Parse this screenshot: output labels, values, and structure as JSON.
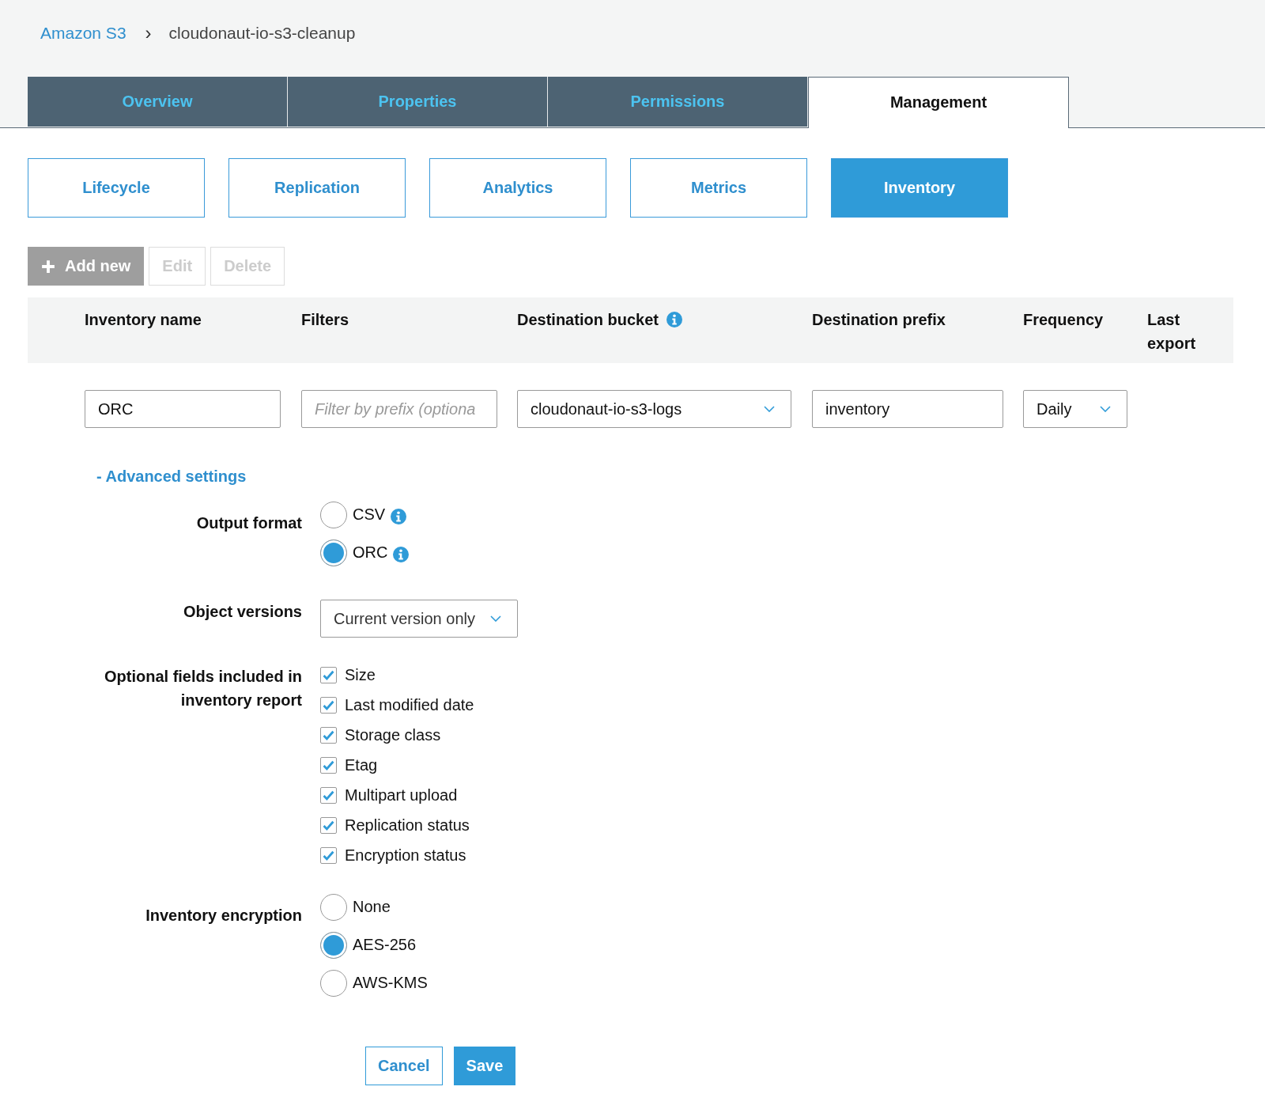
{
  "breadcrumb": {
    "root": "Amazon S3",
    "separator": "›",
    "current": "cloudonaut-io-s3-cleanup"
  },
  "tabs": [
    {
      "label": "Overview",
      "selected": false
    },
    {
      "label": "Properties",
      "selected": false
    },
    {
      "label": "Permissions",
      "selected": false
    },
    {
      "label": "Management",
      "selected": true
    }
  ],
  "subtabs": [
    {
      "label": "Lifecycle",
      "selected": false
    },
    {
      "label": "Replication",
      "selected": false
    },
    {
      "label": "Analytics",
      "selected": false
    },
    {
      "label": "Metrics",
      "selected": false
    },
    {
      "label": "Inventory",
      "selected": true
    }
  ],
  "toolbar": [
    {
      "label": "Add new",
      "kind": "add",
      "disabled": true
    },
    {
      "label": "Edit",
      "kind": "plain",
      "disabled": true
    },
    {
      "label": "Delete",
      "kind": "plain",
      "disabled": true
    }
  ],
  "table": {
    "columns": [
      {
        "label": "Inventory name"
      },
      {
        "label": "Filters"
      },
      {
        "label": "Destination bucket",
        "info": true
      },
      {
        "label": "Destination prefix"
      },
      {
        "label": "Frequency"
      },
      {
        "label": "Last export"
      }
    ],
    "row": {
      "name": {
        "value": "ORC"
      },
      "filter": {
        "placeholder": "Filter by prefix (optiona"
      },
      "bucket": {
        "value": "cloudonaut-io-s3-logs"
      },
      "prefix": {
        "value": "inventory"
      },
      "frequency": {
        "value": "Daily"
      }
    }
  },
  "advanced_toggle": "- Advanced settings",
  "output_format": {
    "label": "Output format",
    "options": [
      {
        "label": "CSV",
        "selected": false,
        "info": true
      },
      {
        "label": "ORC",
        "selected": true,
        "info": true
      }
    ]
  },
  "object_versions": {
    "label": "Object versions",
    "value": "Current version only"
  },
  "optional_fields": {
    "label": "Optional fields included in inventory report",
    "items": [
      {
        "label": "Size",
        "checked": true
      },
      {
        "label": "Last modified date",
        "checked": true
      },
      {
        "label": "Storage class",
        "checked": true
      },
      {
        "label": "Etag",
        "checked": true
      },
      {
        "label": "Multipart upload",
        "checked": true
      },
      {
        "label": "Replication status",
        "checked": true
      },
      {
        "label": "Encryption status",
        "checked": true
      }
    ]
  },
  "encryption": {
    "label": "Inventory encryption",
    "options": [
      {
        "label": "None",
        "selected": false
      },
      {
        "label": "AES-256",
        "selected": true
      },
      {
        "label": "AWS-KMS",
        "selected": false
      }
    ]
  },
  "actions": [
    {
      "label": "Cancel",
      "kind": "secondary"
    },
    {
      "label": "Save",
      "kind": "primary"
    }
  ]
}
